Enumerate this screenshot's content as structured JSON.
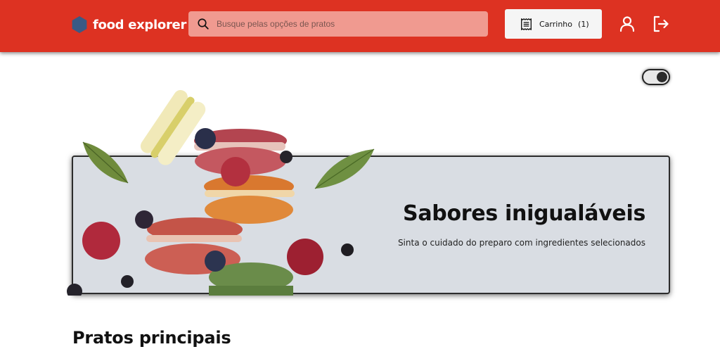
{
  "header": {
    "brand_name": "food explorer",
    "search": {
      "placeholder": "Busque pelas opções de pratos",
      "value": ""
    },
    "cart": {
      "label": "Carrinho",
      "count": "1",
      "icon": "receipt-icon"
    },
    "user_icon": "user-icon",
    "logout_icon": "logout-icon",
    "accent_color": "#dd3222"
  },
  "theme_toggle": {
    "state": "on"
  },
  "hero": {
    "title": "Sabores inigualáveis",
    "subtitle": "Sinta o cuidado do preparo com ingredientes selecionados",
    "image": "macarons-and-berries-illustration",
    "background_color": "#d9dde3"
  },
  "sections": [
    {
      "title": "Pratos principais"
    }
  ]
}
